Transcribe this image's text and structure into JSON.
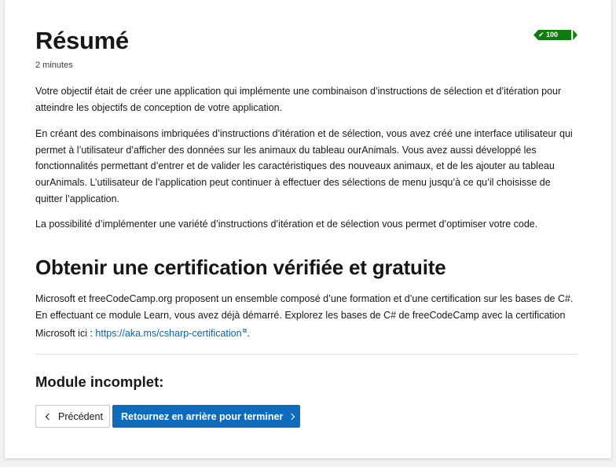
{
  "header": {
    "title": "Résumé",
    "duration": "2 minutes",
    "xp": "100 XP"
  },
  "summary": {
    "paragraphs": [
      "Votre objectif était de créer une application qui implémente une combinaison d’instructions de sélection et d’itération pour atteindre les objectifs de conception de votre application.",
      "En créant des combinaisons imbriquées d’instructions d’itération et de sélection, vous avez créé une interface utilisateur qui permet à l’utilisateur d’afficher des données sur les animaux du tableau ourAnimals. Vous avez aussi développé les fonctionnalités permettant d’entrer et de valider les caractéristiques des nouveaux animaux, et de les ajouter au tableau ourAnimals. L’utilisateur de l’application peut continuer à effectuer des sélections de menu jusqu’à ce qu’il choisisse de quitter l’application.",
      "La possibilité d’implémenter une variété d’instructions d’itération et de sélection vous permet d’optimiser votre code."
    ]
  },
  "certification": {
    "heading": "Obtenir une certification vérifiée et gratuite",
    "text": "Microsoft et freeCodeCamp.org proposent un ensemble composé d’une formation et d’une certification sur les bases de C#. En effectuant ce module Learn, vous avez déjà démarré. Explorez les bases de C# de freeCodeCamp avec la certification Microsoft ici : ",
    "link_text": "https://aka.ms/csharp-certification",
    "after_link": "."
  },
  "module": {
    "status": "Module incomplet:",
    "prev_label": "Précédent",
    "next_label": "Retournez en arrière pour terminer"
  },
  "colors": {
    "accent": "#0f6cbd",
    "xp_badge": "#107c10",
    "link": "#0065b3"
  },
  "icons": {
    "xp": "checkmark-icon",
    "link": "external-link-icon",
    "prev": "chevron-left-icon",
    "next": "chevron-right-icon"
  }
}
